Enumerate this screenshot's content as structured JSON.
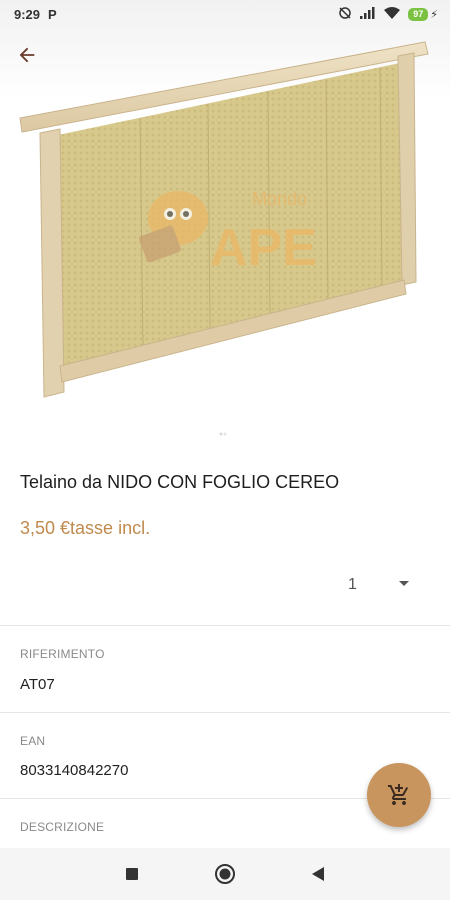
{
  "status_bar": {
    "time": "9:29",
    "app_indicator": "P",
    "battery_level": "97",
    "icons": [
      "p-notification-icon",
      "no-alarm-icon",
      "signal-icon",
      "wifi-icon",
      "battery-icon",
      "charging-icon"
    ]
  },
  "header": {
    "back_icon": "arrow-back-icon"
  },
  "image": {
    "watermark_small": "Mondo",
    "watermark_big": "APE",
    "colors": {
      "frame_wood": "#e8d8b8",
      "wax_sheet": "#d8c98f",
      "watermark": "#e8b96a"
    }
  },
  "product": {
    "title": "Telaino da NIDO CON FOGLIO CEREO",
    "price": "3,50 €tasse incl.",
    "quantity": "1"
  },
  "details": [
    {
      "label": "RIFERIMENTO",
      "value": "AT07"
    },
    {
      "label": "EAN",
      "value": "8033140842270"
    },
    {
      "label": "DESCRIZIONE",
      "value": ""
    }
  ],
  "fab": {
    "icon": "add-to-cart-icon",
    "color": "#c9955f"
  },
  "colors": {
    "accent": "#c08a4e"
  },
  "nav_bar": {
    "icons": [
      "recent-apps-icon",
      "home-icon",
      "back-triangle-icon"
    ]
  }
}
